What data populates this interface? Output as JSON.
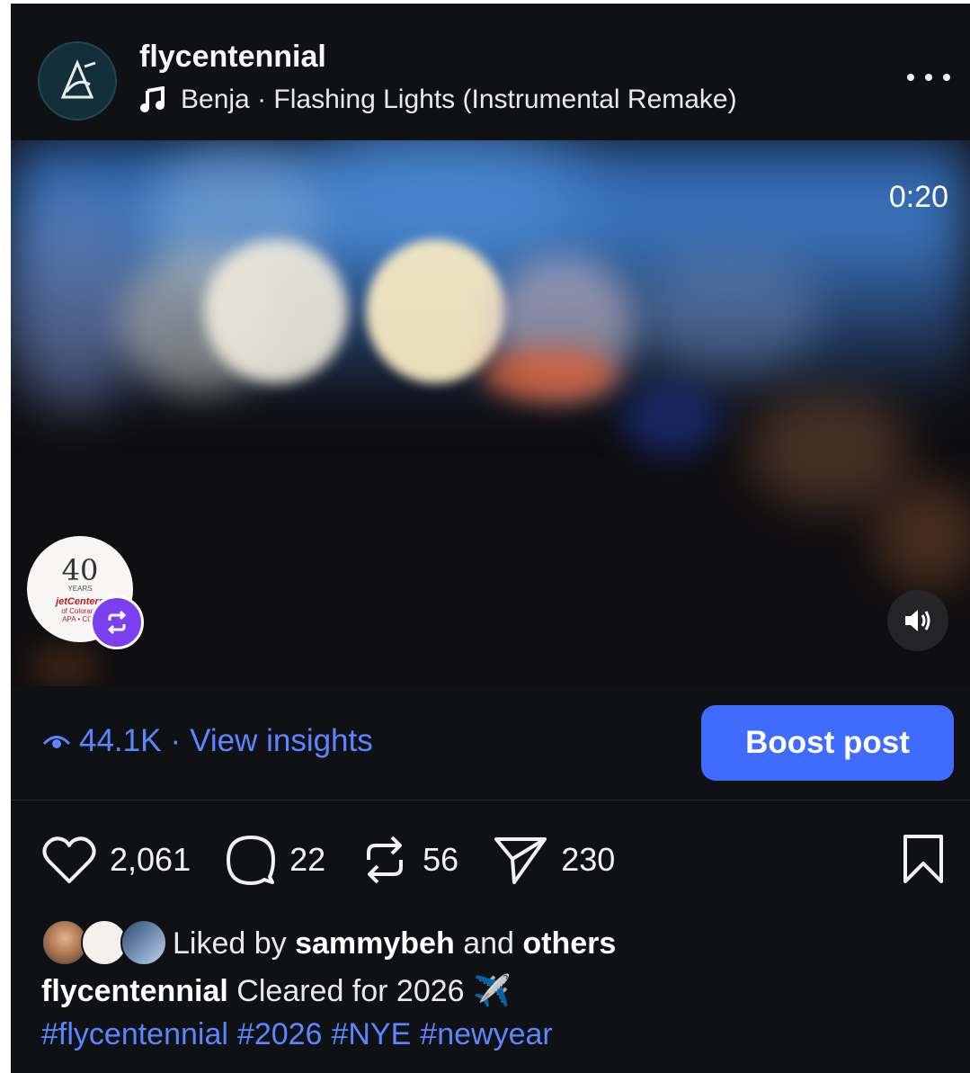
{
  "header": {
    "username": "flycentennial",
    "music": "Benja · Flashing Lights (Instrumental Remake)"
  },
  "video": {
    "timer": "0:20",
    "repost_avatar": {
      "number": "40",
      "years": "YEARS",
      "brand": "jetCenters",
      "brand_sub": "of Colorado",
      "tagline": "APA • COS"
    }
  },
  "insights": {
    "views": "44.1K",
    "separator": "·",
    "link_label": "View insights"
  },
  "boost_label": "Boost post",
  "actions": {
    "likes": "2,061",
    "comments": "22",
    "reposts": "56",
    "shares": "230"
  },
  "liked_by": {
    "prefix": "Liked by",
    "user": "sammybeh",
    "connector": "and",
    "others": "others"
  },
  "caption": {
    "username": "flycentennial",
    "text": "Cleared for 2026",
    "emoji": "✈️"
  },
  "hashtags": [
    "#flycentennial",
    "#2026",
    "#NYE",
    "#newyear"
  ],
  "colors": {
    "background": "#0f1115",
    "accent": "#3f6bff",
    "link": "#5a87ff",
    "repost_badge": "#7c3ff0"
  },
  "icons": [
    "more-icon",
    "music-note-icon",
    "eye-icon",
    "heart-icon",
    "comment-icon",
    "repost-icon",
    "share-icon",
    "bookmark-icon",
    "volume-icon"
  ]
}
